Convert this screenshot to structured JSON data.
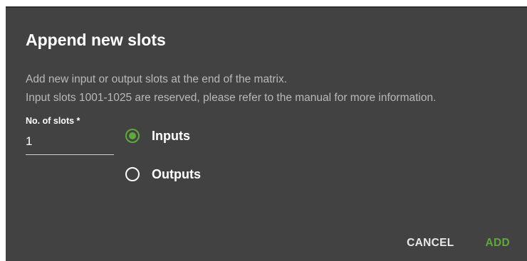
{
  "dialog": {
    "title": "Append new slots",
    "description_line1": "Add new input or output slots at the end of the matrix.",
    "description_line2": "Input slots 1001-1025 are reserved, please refer to the manual for more information."
  },
  "slots_field": {
    "label": "No. of slots *",
    "value": "1"
  },
  "slot_type": {
    "options": [
      {
        "label": "Inputs",
        "checked": true
      },
      {
        "label": "Outputs",
        "checked": false
      }
    ]
  },
  "actions": {
    "cancel_label": "CANCEL",
    "add_label": "ADD"
  },
  "colors": {
    "dialog_background": "#424242",
    "accent": "#5fa83a"
  }
}
